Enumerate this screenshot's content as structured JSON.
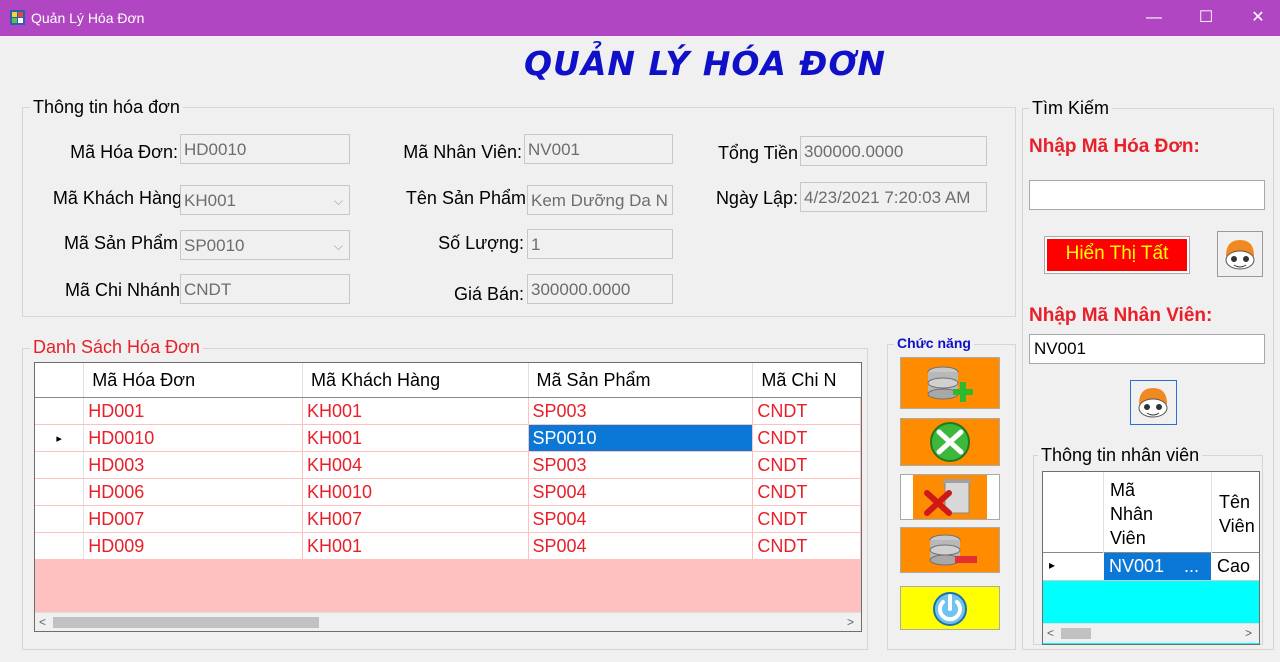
{
  "window": {
    "title": "Quản Lý Hóa Đơn",
    "minimize": "—",
    "maximize": "☐",
    "close": "✕"
  },
  "heading": "QUẢN LÝ HÓA ĐƠN",
  "info": {
    "group_label": "Thông tin hóa đơn",
    "ma_hoa_don": {
      "label": "Mã Hóa Đơn:",
      "value": "HD0010"
    },
    "ma_khach_hang": {
      "label": "Mã Khách Hàng",
      "value": "KH001"
    },
    "ma_san_pham": {
      "label": "Mã Sản Phẩm",
      "value": "SP0010"
    },
    "ma_chi_nhanh": {
      "label": "Mã Chi Nhánh",
      "value": "CNDT"
    },
    "ma_nhan_vien": {
      "label": "Mã Nhân Viên:",
      "value": "NV001"
    },
    "ten_san_pham": {
      "label": "Tên Sản Phẩm",
      "value": "Kem Dưỡng Da N"
    },
    "so_luong": {
      "label": "Số Lượng:",
      "value": "1"
    },
    "gia_ban": {
      "label": "Giá Bán:",
      "value": "300000.0000"
    },
    "tong_tien": {
      "label": "Tổng Tiền",
      "value": "300000.0000"
    },
    "ngay_lap": {
      "label": "Ngày Lập:",
      "value": "4/23/2021 7:20:03 AM"
    }
  },
  "list": {
    "group_label": "Danh Sách Hóa Đơn",
    "columns": [
      "Mã Hóa Đơn",
      "Mã Khách Hàng",
      "Mã Sản Phẩm",
      "Mã Chi N"
    ],
    "rows": [
      {
        "marker": "",
        "cells": [
          "HD001",
          "KH001",
          "SP003",
          "CNDT"
        ]
      },
      {
        "marker": "▸",
        "cells": [
          "HD0010",
          "KH001",
          "SP0010",
          "CNDT"
        ]
      },
      {
        "marker": "",
        "cells": [
          "HD003",
          "KH004",
          "SP003",
          "CNDT"
        ]
      },
      {
        "marker": "",
        "cells": [
          "HD006",
          "KH0010",
          "SP004",
          "CNDT"
        ]
      },
      {
        "marker": "",
        "cells": [
          "HD007",
          "KH007",
          "SP004",
          "CNDT"
        ]
      },
      {
        "marker": "",
        "cells": [
          "HD009",
          "KH001",
          "SP004",
          "CNDT"
        ]
      }
    ],
    "scroll_left": "<",
    "scroll_right": ">"
  },
  "functions": {
    "group_label": "Chức năng"
  },
  "search": {
    "group_label": "Tìm Kiếm",
    "invoice_label": "Nhập Mã Hóa Đơn:",
    "invoice_value": "",
    "show_all_label": "Hiển Thị Tất",
    "employee_label": "Nhập Mã Nhân Viên:",
    "employee_value": "NV001"
  },
  "employee": {
    "group_label": "Thông tin nhân viên",
    "col1": [
      "Mã",
      "Nhân",
      "Viên"
    ],
    "col2": [
      "Tên",
      "Viên"
    ],
    "row_marker": "▸",
    "row_value1": "NV001",
    "row_ellipsis": "...",
    "row_value2": "Cao",
    "scroll_left": "<",
    "scroll_right": ">"
  },
  "colors": {
    "titlebar": "#b146c2",
    "heading": "#1010c8",
    "accent_red": "#e8202a",
    "selection": "#0b78d7",
    "grid_bg": "#ffc0c0",
    "btn_orange": "#ff8c00",
    "btn_yellow": "#ffff00",
    "emp_grid_bg": "#00ffff"
  },
  "icons": [
    "app-icon",
    "database-add-icon",
    "tools-edit-icon",
    "recycle-delete-icon",
    "database-remove-icon",
    "power-exit-icon",
    "search-icon"
  ]
}
